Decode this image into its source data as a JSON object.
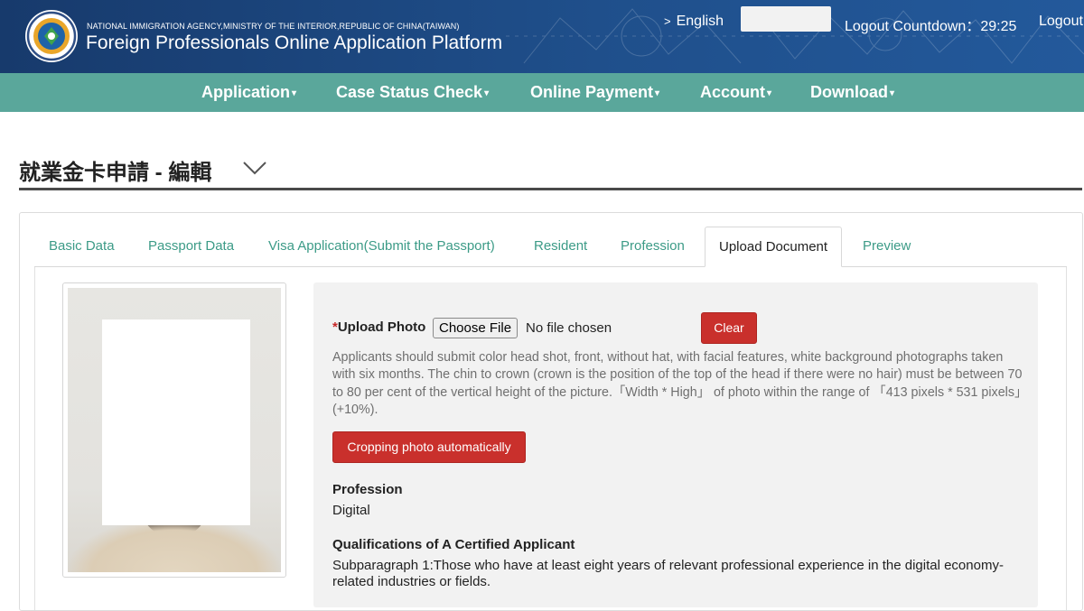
{
  "header": {
    "agency": "NATIONAL IMMIGRATION AGENCY,MINISTRY OF THE INTERIOR,REPUBLIC OF CHINA(TAIWAN)",
    "title": "Foreign Professionals Online Application Platform",
    "language": "English",
    "countdown_label": "Logout Countdown：29:25",
    "logout_label": "Logout",
    "logo_icon": "agency-seal-icon"
  },
  "nav": {
    "items": [
      {
        "label": "Application"
      },
      {
        "label": "Case Status Check"
      },
      {
        "label": "Online Payment"
      },
      {
        "label": "Account"
      },
      {
        "label": "Download"
      }
    ]
  },
  "page": {
    "title": "就業金卡申請 - 編輯"
  },
  "tabs": [
    {
      "label": "Basic Data"
    },
    {
      "label": "Passport Data"
    },
    {
      "label": "Visa Application(Submit the Passport)"
    },
    {
      "label": "Resident"
    },
    {
      "label": "Profession"
    },
    {
      "label": "Upload Document"
    },
    {
      "label": "Preview"
    }
  ],
  "active_tab": "Upload Document",
  "upload": {
    "required_mark": "*",
    "label": "Upload Photo",
    "choose_button": "Choose File",
    "file_status": "No file chosen",
    "clear_button": "Clear",
    "help_text": "Applicants should submit color head shot, front, without hat, with facial features, white background photographs taken with six months. The chin to crown (crown is the position of the top of the head if there were no hair) must be between 70 to 80 per cent of the vertical height of the picture.「Width * High」 of photo within the range of 「413 pixels * 531 pixels」 (+10%).",
    "crop_button": "Cropping photo automatically"
  },
  "fields": {
    "profession_label": "Profession",
    "profession_value": "Digital",
    "qualification_label": "Qualifications of A Certified Applicant",
    "qualification_value": "Subparagraph 1:Those who have at least eight years of relevant professional experience in the digital economy-related industries or fields."
  },
  "colors": {
    "header_blue": "#1f4f8b",
    "nav_teal": "#5aa79b",
    "tab_text": "#3c9b87",
    "danger_red": "#c9302c"
  }
}
